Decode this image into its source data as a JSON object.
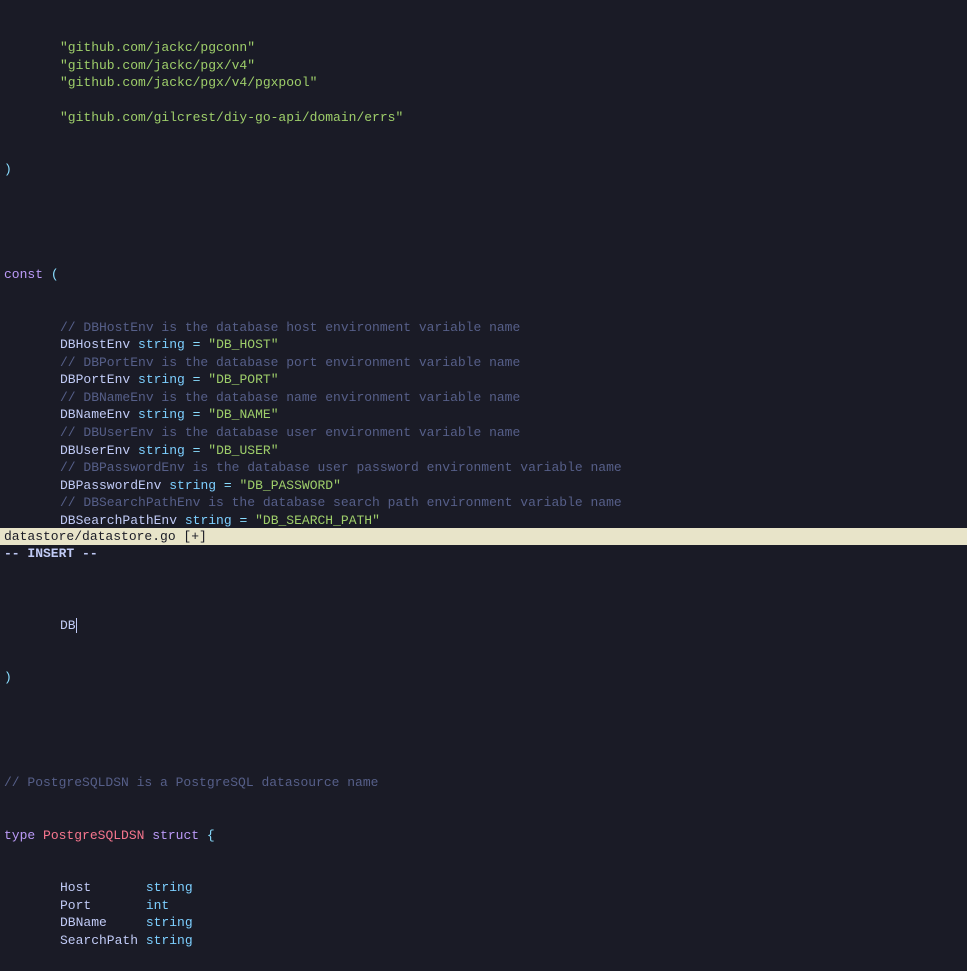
{
  "imports": [
    "\"github.com/jackc/pgconn\"",
    "\"github.com/jackc/pgx/v4\"",
    "\"github.com/jackc/pgx/v4/pgxpool\"",
    "",
    "\"github.com/gilcrest/diy-go-api/domain/errs\""
  ],
  "close_paren": ")",
  "const_open": "const (",
  "const_block": [
    {
      "type": "comment",
      "text": "// DBHostEnv is the database host environment variable name"
    },
    {
      "type": "decl",
      "name": "DBHostEnv",
      "typ": "string",
      "val": "\"DB_HOST\""
    },
    {
      "type": "comment",
      "text": "// DBPortEnv is the database port environment variable name"
    },
    {
      "type": "decl",
      "name": "DBPortEnv",
      "typ": "string",
      "val": "\"DB_PORT\""
    },
    {
      "type": "comment",
      "text": "// DBNameEnv is the database name environment variable name"
    },
    {
      "type": "decl",
      "name": "DBNameEnv",
      "typ": "string",
      "val": "\"DB_NAME\""
    },
    {
      "type": "comment",
      "text": "// DBUserEnv is the database user environment variable name"
    },
    {
      "type": "decl",
      "name": "DBUserEnv",
      "typ": "string",
      "val": "\"DB_USER\""
    },
    {
      "type": "comment",
      "text": "// DBPasswordEnv is the database user password environment variable name"
    },
    {
      "type": "decl",
      "name": "DBPasswordEnv",
      "typ": "string",
      "val": "\"DB_PASSWORD\""
    },
    {
      "type": "comment",
      "text": "// DBSearchPathEnv is the database search path environment variable name"
    },
    {
      "type": "decl",
      "name": "DBSearchPathEnv",
      "typ": "string",
      "val": "\"DB_SEARCH_PATH\""
    }
  ],
  "cursor_line": "DB",
  "const_close": ")",
  "struct_comment": "// PostgreSQLDSN is a PostgreSQL datasource name",
  "struct_decl": {
    "kw_type": "type",
    "name": "PostgreSQLDSN",
    "kw_struct": "struct",
    "brace": "{"
  },
  "struct_fields": [
    {
      "name": "Host",
      "typ": "string"
    },
    {
      "name": "Port",
      "typ": "int"
    },
    {
      "name": "DBName",
      "typ": "string"
    },
    {
      "name": "SearchPath",
      "typ": "string"
    }
  ],
  "statusbar": "datastore/datastore.go [+]",
  "modeline": "-- INSERT --"
}
